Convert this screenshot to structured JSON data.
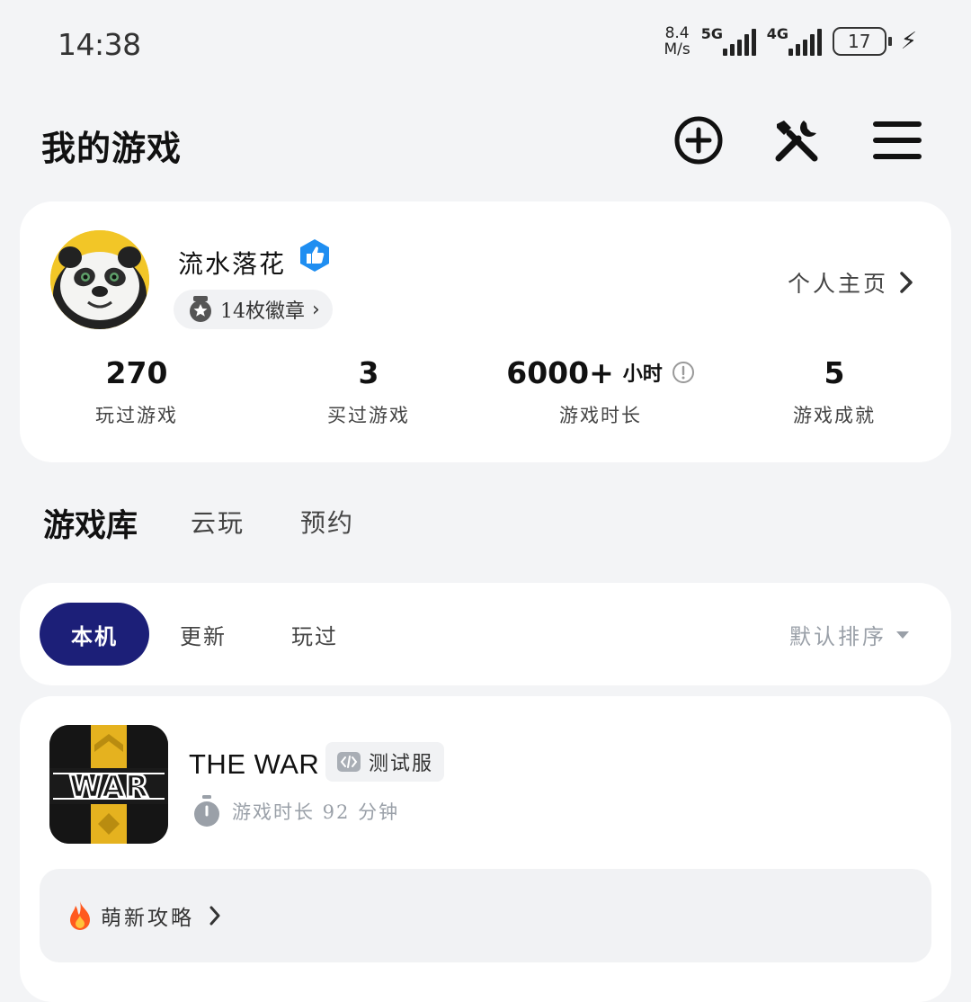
{
  "status_bar": {
    "time": "14:38",
    "net_speed_value": "8.4",
    "net_speed_unit": "M/s",
    "sim1": "5G",
    "sim2": "4G",
    "battery": "17"
  },
  "header": {
    "title": "我的游戏",
    "add_icon": "plus-circle-icon",
    "tools_icon": "tools-icon",
    "menu_icon": "hamburger-menu-icon"
  },
  "profile": {
    "username": "流水落花",
    "badge_label": "14枚徽章",
    "profile_link": "个人主页",
    "stats": [
      {
        "value": "270",
        "unit": "",
        "label": "玩过游戏"
      },
      {
        "value": "3",
        "unit": "",
        "label": "买过游戏"
      },
      {
        "value": "6000+",
        "unit": "小时",
        "label": "游戏时长"
      },
      {
        "value": "5",
        "unit": "",
        "label": "游戏成就"
      }
    ]
  },
  "library_tabs": [
    {
      "label": "游戏库",
      "active": true
    },
    {
      "label": "云玩",
      "active": false
    },
    {
      "label": "预约",
      "active": false
    }
  ],
  "filters": {
    "chips": [
      {
        "label": "本机",
        "active": true
      },
      {
        "label": "更新",
        "active": false
      },
      {
        "label": "玩过",
        "active": false
      }
    ],
    "sort_label": "默认排序"
  },
  "game": {
    "name": "THE WAR",
    "tag": "测试服",
    "play_time": "游戏时长 92 分钟",
    "guide": "萌新攻略"
  },
  "colors": {
    "accent_navy": "#1c1f78",
    "accent_teal": "#1ec8b7",
    "verified_blue": "#1f8ef1",
    "fire_orange": "#ff5a1f"
  }
}
